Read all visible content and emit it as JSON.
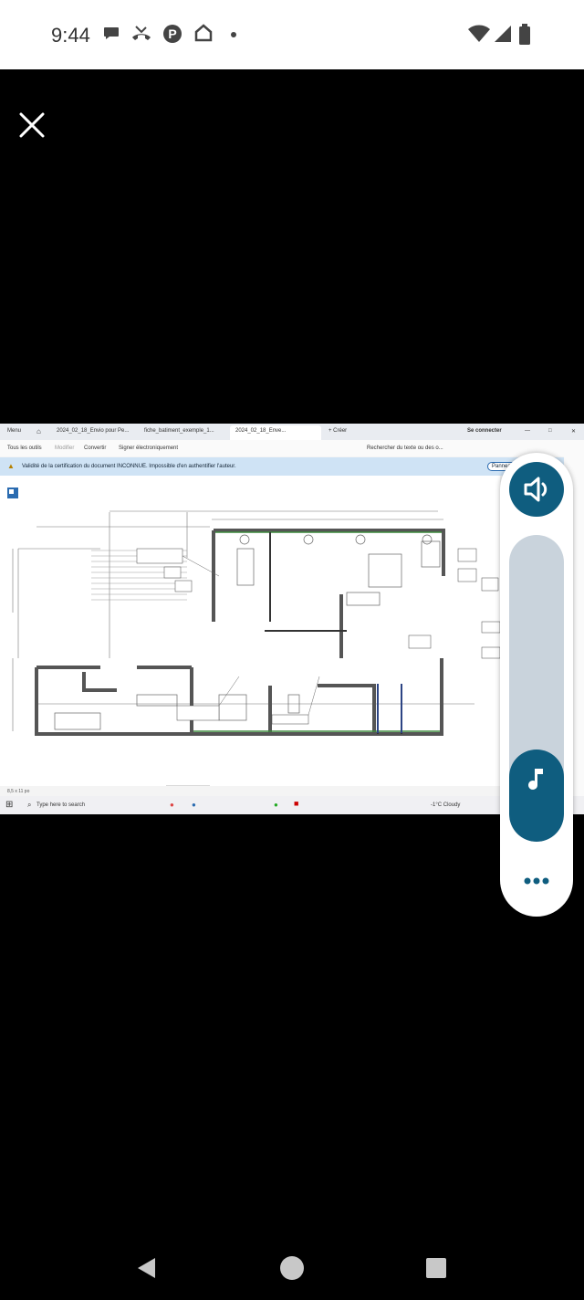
{
  "status_bar": {
    "time": "9:44",
    "left_icons": [
      "chat-bubble-icon",
      "missed-call-icon",
      "parking-icon",
      "home-icon",
      "dot-icon"
    ],
    "right_icons": [
      "wifi-icon",
      "cell-signal-icon",
      "battery-icon"
    ]
  },
  "viewer": {
    "close_icon": "close-icon"
  },
  "screenshot": {
    "browser_tabs": {
      "menu": "Menu",
      "tab1": "2024_02_18_Envio pour Pe...",
      "tab2": "fiche_batiment_exemple_1...",
      "tab3": "2024_02_18_Enve...",
      "new_tab": "+ Créer",
      "sign_in": "Se connecter"
    },
    "menu": {
      "all_tools": "Tous les outils",
      "edit": "Modifier",
      "convert": "Convertir",
      "e_sign": "Signer électroniquement",
      "search": "Rechercher du texte ou des o..."
    },
    "info_bar": {
      "message": "Validité de la certification du document INCONNUE. Impossible d'en authentifier l'auteur.",
      "button": "Panneau"
    },
    "taskbar": {
      "search_placeholder": "Type here to search",
      "weather": "-1°C Cloudy",
      "page_size": "8,5 x 11 po"
    }
  },
  "media_panel": {
    "volume_level": 0.3,
    "accent_color": "#0f5d7f",
    "track_color": "#c9d3dc",
    "icons": [
      "volume-icon",
      "music-note-icon",
      "more-icon"
    ]
  },
  "nav_bar": {
    "icons": [
      "back-icon",
      "home-icon",
      "recents-icon"
    ]
  }
}
